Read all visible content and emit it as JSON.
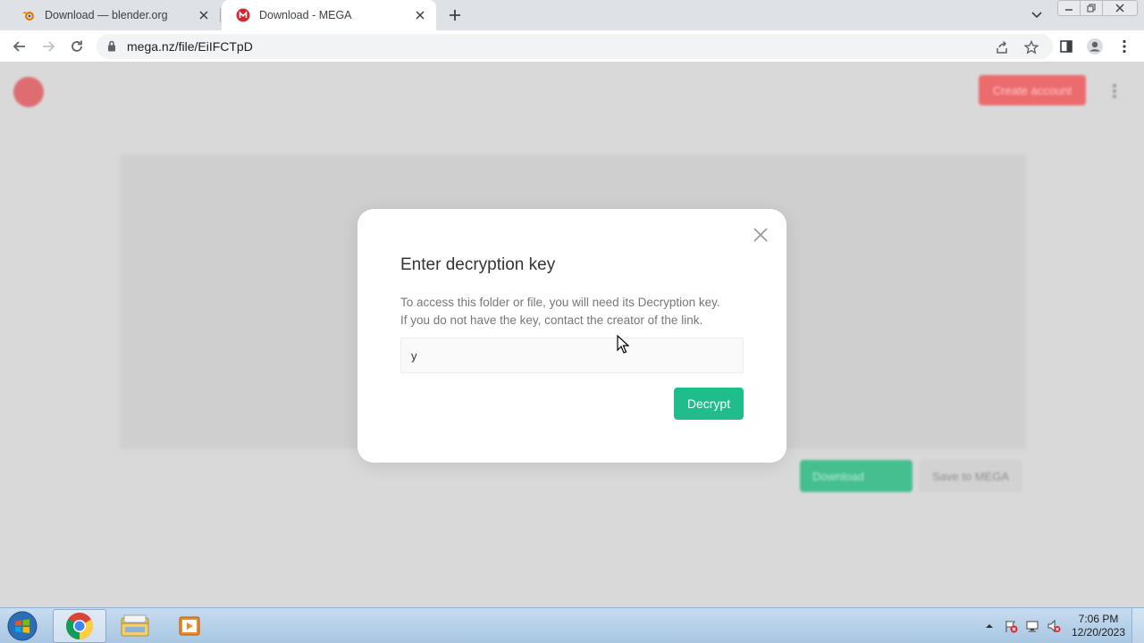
{
  "browser": {
    "tabs": [
      {
        "title": "Download — blender.org",
        "favicon": "blender-icon",
        "active": false
      },
      {
        "title": "Download - MEGA",
        "favicon": "mega-icon",
        "active": true
      }
    ],
    "address_bar": {
      "url": "mega.nz/file/EiIFCTpD"
    }
  },
  "page": {
    "header": {
      "create_account_label": "Create account"
    },
    "file_actions": {
      "download_label": "Download",
      "save_label": "Save to MEGA"
    }
  },
  "dialog": {
    "title": "Enter decryption key",
    "description_line1": "To access this folder or file, you will need its Decryption key.",
    "description_line2": "If you do not have the key, contact the creator of the link.",
    "key_input_value": "y",
    "decrypt_label": "Decrypt"
  },
  "taskbar": {
    "pinned": [
      "chrome-icon",
      "file-explorer-icon",
      "media-player-icon"
    ],
    "clock_time": "7:06 PM",
    "clock_date": "12/20/2023"
  },
  "colors": {
    "mega_red": "#d9272e",
    "decrypt_green": "#1ebd8b",
    "page_overlay": "#d9d9d9"
  }
}
